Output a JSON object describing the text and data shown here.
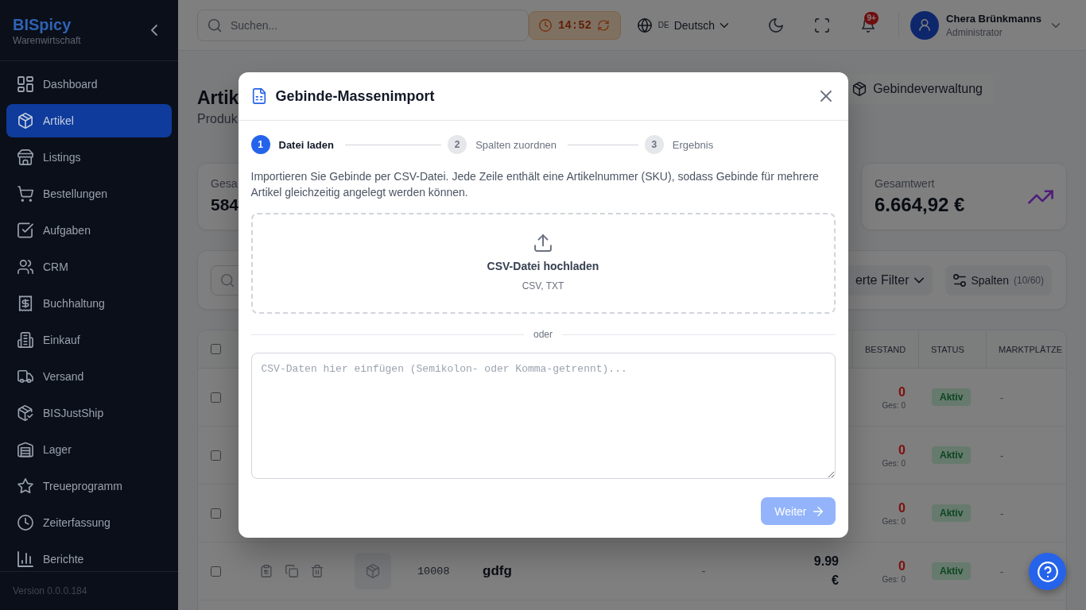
{
  "sidebar": {
    "brand": "BISpicy",
    "tagline": "Warenwirtschaft",
    "items": [
      {
        "label": "Dashboard",
        "selected": false
      },
      {
        "label": "Artikel",
        "selected": true
      },
      {
        "label": "Listings",
        "selected": false
      },
      {
        "label": "Bestellungen",
        "selected": false
      },
      {
        "label": "Aufgaben",
        "selected": false
      },
      {
        "label": "CRM",
        "selected": false
      },
      {
        "label": "Buchhaltung",
        "selected": false
      },
      {
        "label": "Einkauf",
        "selected": false
      },
      {
        "label": "Versand",
        "selected": false
      },
      {
        "label": "BISJustShip",
        "selected": false
      },
      {
        "label": "Lager",
        "selected": false
      },
      {
        "label": "Treueprogramm",
        "selected": false
      },
      {
        "label": "Zeiterfassung",
        "selected": false
      },
      {
        "label": "Berichte",
        "selected": false
      }
    ],
    "version": "Version 0.0.0.184"
  },
  "topbar": {
    "search": {
      "placeholder": "Suchen..."
    },
    "timer": "14:52",
    "language": {
      "code": "DE",
      "label": "Deutsch"
    },
    "notification_badge": "9+",
    "user": {
      "name": "Chera Brünkmanns",
      "role": "Administrator"
    }
  },
  "page": {
    "title": "Artik",
    "subtitle": "Produk",
    "action_button": "Gebindeverwaltung"
  },
  "stats": [
    {
      "kind": "plain",
      "label": "Gesa",
      "value": "584"
    },
    {
      "kind": "trend",
      "label": "Gesamtwert",
      "value": "6.664,92 €"
    }
  ],
  "filters": {
    "advanced_filter": "erte Filter",
    "columns_button": {
      "label": "Spalten",
      "count": "(10/60)"
    }
  },
  "table": {
    "select_all": {
      "checked": false
    },
    "columns": [
      "BESTAND",
      "STATUS",
      "MARKTPLÄTZE"
    ],
    "rows": [
      {
        "checked": false,
        "stock": "0",
        "stock_total": "Ges: 0",
        "status": "Aktiv",
        "marketplaces": "-"
      },
      {
        "checked": false,
        "stock": "0",
        "stock_total": "Ges: 0",
        "status": "Aktiv",
        "marketplaces": "-"
      },
      {
        "checked": false,
        "stock": "0",
        "stock_total": "Ges: 0",
        "status": "Aktiv",
        "marketplaces": "-"
      },
      {
        "checked": false,
        "sku": "10008",
        "name": "gdfg",
        "column_6": "-",
        "price": "9.99 €",
        "stock": "0",
        "stock_total": "Ges: 0",
        "status": "Aktiv",
        "marketplaces": "-"
      }
    ]
  },
  "modal": {
    "title": "Gebinde-Massenimport",
    "steps": [
      {
        "number": "1",
        "label": "Datei laden",
        "active": true
      },
      {
        "number": "2",
        "label": "Spalten zuordnen",
        "active": false
      },
      {
        "number": "3",
        "label": "Ergebnis",
        "active": false
      }
    ],
    "description": "Importieren Sie Gebinde per CSV-Datei. Jede Zeile enthält eine Artikelnummer (SKU), sodass Gebinde für mehrere Artikel gleichzeitig angelegt werden können.",
    "dropzone": {
      "title": "CSV-Datei hochladen",
      "formats": "CSV, TXT"
    },
    "divider": "oder",
    "textarea": {
      "placeholder": "CSV-Daten hier einfügen (Semikolon- oder Komma-getrennt)..."
    },
    "next_button": {
      "label": "Weiter",
      "disabled": true
    }
  }
}
